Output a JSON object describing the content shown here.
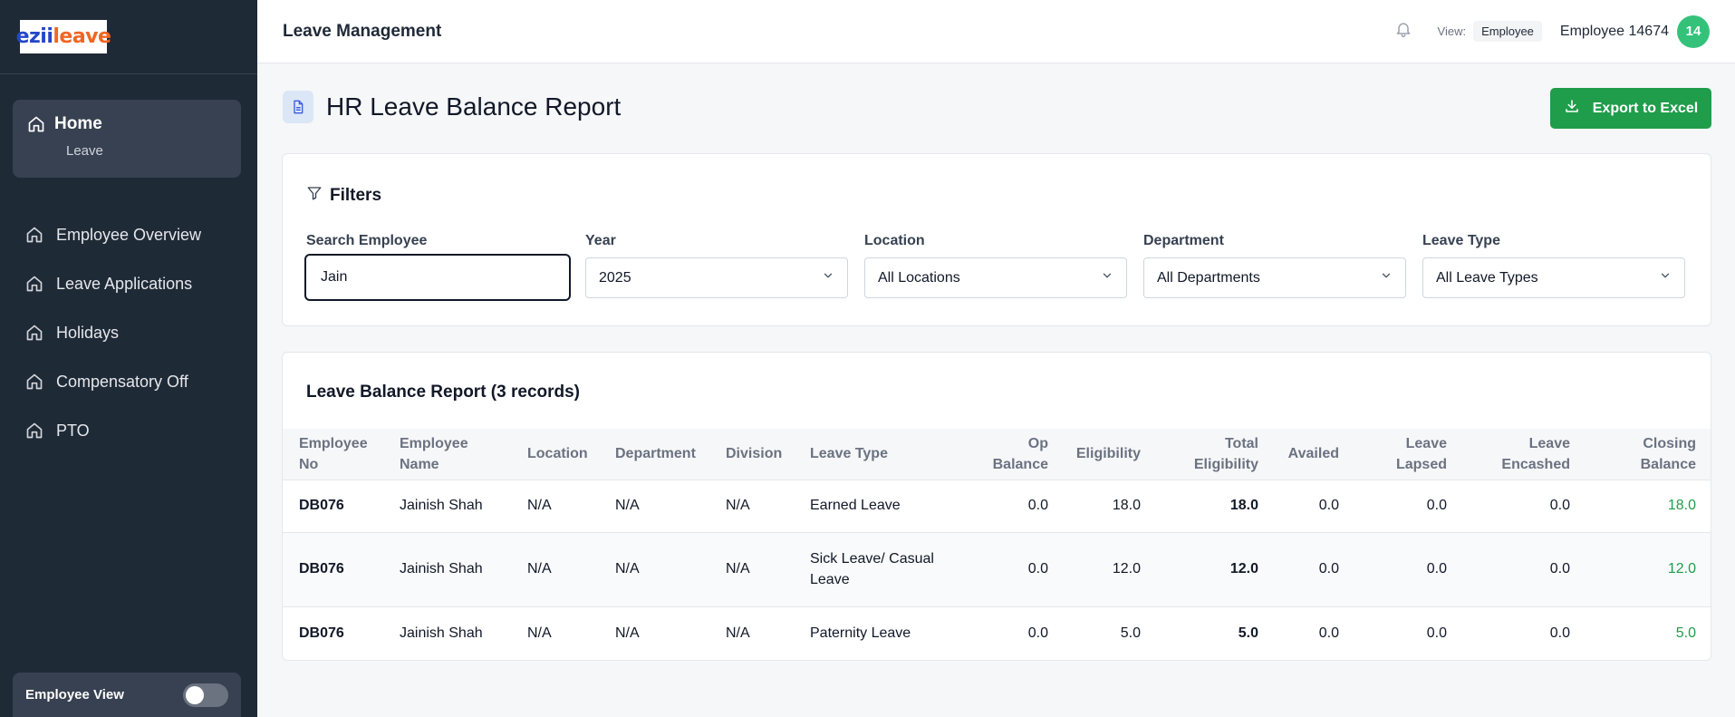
{
  "brand": {
    "logo_part1": "ezii",
    "logo_part2": "leave"
  },
  "sidebar": {
    "home": {
      "label": "Home",
      "sub": "Leave"
    },
    "items": [
      {
        "label": "Employee Overview"
      },
      {
        "label": "Leave Applications"
      },
      {
        "label": "Holidays"
      },
      {
        "label": "Compensatory Off"
      },
      {
        "label": "PTO"
      }
    ],
    "employee_view_label": "Employee View"
  },
  "topbar": {
    "title": "Leave Management",
    "view_label": "View:",
    "view_value": "Employee",
    "user_name": "Employee 14674",
    "avatar_text": "14"
  },
  "page": {
    "title": "HR Leave Balance Report",
    "export_label": "Export to Excel"
  },
  "filters": {
    "heading": "Filters",
    "search_label": "Search Employee",
    "search_value": "Jain",
    "year_label": "Year",
    "year_value": "2025",
    "location_label": "Location",
    "location_value": "All Locations",
    "department_label": "Department",
    "department_value": "All Departments",
    "leave_type_label": "Leave Type",
    "leave_type_value": "All Leave Types"
  },
  "report": {
    "title": "Leave Balance Report (3 records)",
    "columns": {
      "emp_no_1": "Employee",
      "emp_no_2": "No",
      "emp_name_1": "Employee",
      "emp_name_2": "Name",
      "location": "Location",
      "department": "Department",
      "division": "Division",
      "leave_type": "Leave Type",
      "op_balance_1": "Op",
      "op_balance_2": "Balance",
      "eligibility": "Eligibility",
      "total_elig_1": "Total",
      "total_elig_2": "Eligibility",
      "availed": "Availed",
      "lapsed_1": "Leave",
      "lapsed_2": "Lapsed",
      "encashed_1": "Leave",
      "encashed_2": "Encashed",
      "closing_1": "Closing",
      "closing_2": "Balance"
    },
    "rows": [
      {
        "emp_no": "DB076",
        "name": "Jainish Shah",
        "location": "N/A",
        "department": "N/A",
        "division": "N/A",
        "leave_type_1": "Earned Leave",
        "leave_type_2": "",
        "op": "0.0",
        "elig": "18.0",
        "total": "18.0",
        "availed": "0.0",
        "lapsed": "0.0",
        "encashed": "0.0",
        "closing": "18.0"
      },
      {
        "emp_no": "DB076",
        "name": "Jainish Shah",
        "location": "N/A",
        "department": "N/A",
        "division": "N/A",
        "leave_type_1": "Sick Leave/ Casual",
        "leave_type_2": "Leave",
        "op": "0.0",
        "elig": "12.0",
        "total": "12.0",
        "availed": "0.0",
        "lapsed": "0.0",
        "encashed": "0.0",
        "closing": "12.0"
      },
      {
        "emp_no": "DB076",
        "name": "Jainish Shah",
        "location": "N/A",
        "department": "N/A",
        "division": "N/A",
        "leave_type_1": "Paternity Leave",
        "leave_type_2": "",
        "op": "0.0",
        "elig": "5.0",
        "total": "5.0",
        "availed": "0.0",
        "lapsed": "0.0",
        "encashed": "0.0",
        "closing": "5.0"
      }
    ]
  },
  "colors": {
    "sidebar_bg": "#1f2a37",
    "accent_green": "#1f9d4a",
    "avatar_green": "#34c27a"
  },
  "icons": [
    "home-icon",
    "bell-icon",
    "document-icon",
    "download-icon",
    "filter-icon",
    "chevron-down-icon"
  ]
}
